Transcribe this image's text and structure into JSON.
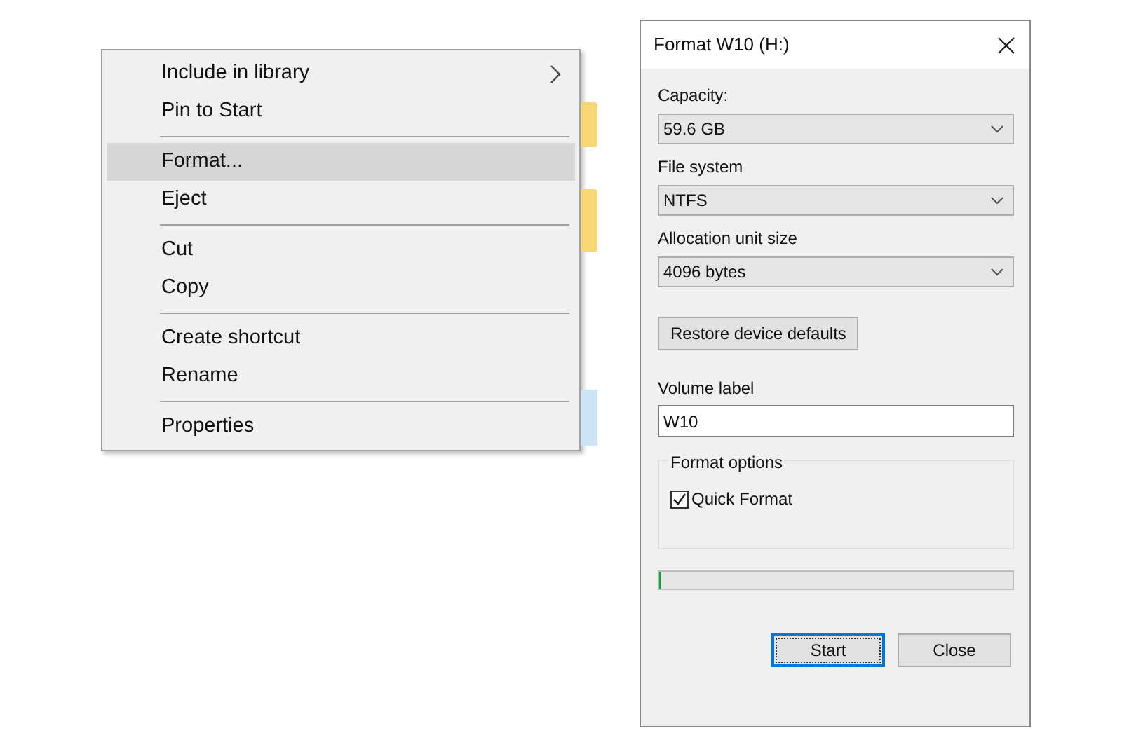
{
  "context_menu": {
    "items": [
      {
        "kind": "item",
        "label": "Include in library",
        "selected": false,
        "submenu": true
      },
      {
        "kind": "item",
        "label": "Pin to Start",
        "selected": false,
        "submenu": false
      },
      {
        "kind": "separator"
      },
      {
        "kind": "item",
        "label": "Format...",
        "selected": true,
        "submenu": false
      },
      {
        "kind": "item",
        "label": "Eject",
        "selected": false,
        "submenu": false
      },
      {
        "kind": "separator"
      },
      {
        "kind": "item",
        "label": "Cut",
        "selected": false,
        "submenu": false
      },
      {
        "kind": "item",
        "label": "Copy",
        "selected": false,
        "submenu": false
      },
      {
        "kind": "separator"
      },
      {
        "kind": "item",
        "label": "Create shortcut",
        "selected": false,
        "submenu": false
      },
      {
        "kind": "item",
        "label": "Rename",
        "selected": false,
        "submenu": false
      },
      {
        "kind": "separator"
      },
      {
        "kind": "item",
        "label": "Properties",
        "selected": false,
        "submenu": false
      }
    ]
  },
  "dialog": {
    "title": "Format W10 (H:)",
    "dropdowns": [
      {
        "label": "Capacity:",
        "value": "59.6 GB"
      },
      {
        "label": "File system",
        "value": "NTFS"
      },
      {
        "label": "Allocation unit size",
        "value": "4096 bytes"
      }
    ],
    "restore_button": "Restore device defaults",
    "volume_label": {
      "label": "Volume label",
      "value": "W10"
    },
    "format_options": {
      "title": "Format options",
      "quick_format": {
        "label": "Quick Format",
        "checked": true
      }
    },
    "progress": {
      "level": 0
    },
    "buttons": [
      {
        "label": "Start",
        "default": true
      },
      {
        "label": "Close",
        "default": false
      }
    ]
  }
}
